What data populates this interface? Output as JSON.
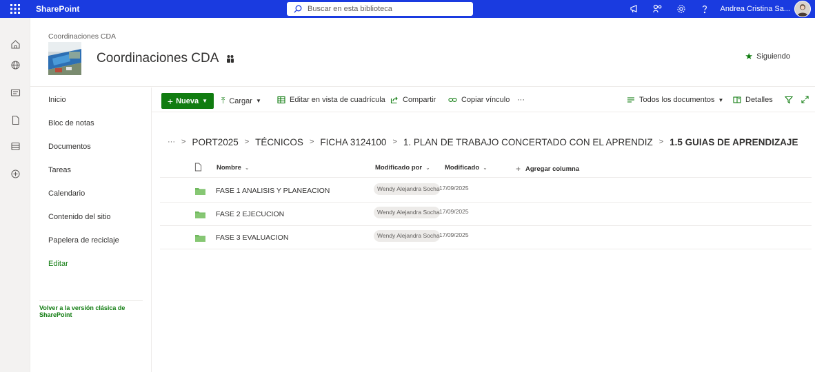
{
  "suite": {
    "brand": "SharePoint",
    "search_placeholder": "Buscar en esta biblioteca",
    "user_name": "Andrea Cristina Sa..."
  },
  "site": {
    "breadcrumb": "Coordinaciones CDA",
    "title": "Coordinaciones CDA",
    "follow_label": "Siguiendo"
  },
  "nav": {
    "items": [
      "Inicio",
      "Bloc de notas",
      "Documentos",
      "Tareas",
      "Calendario",
      "Contenido del sitio",
      "Papelera de reciclaje"
    ],
    "edit": "Editar",
    "classic": "Volver a la versión clásica de SharePoint"
  },
  "commands": {
    "new": "Nueva",
    "upload": "Cargar",
    "grid": "Editar en vista de cuadrícula",
    "share": "Compartir",
    "copy_link": "Copiar vínculo",
    "more": "···",
    "view": "Todos los documentos",
    "details": "Detalles"
  },
  "breadcrumb": {
    "ellipsis": "···",
    "items": [
      "PORT2025",
      "TÉCNICOS",
      "FICHA 3124100",
      "1. PLAN DE TRABAJO CONCERTADO CON EL APRENDIZ"
    ],
    "current": "1.5 GUIAS DE APRENDIZAJE"
  },
  "columns": {
    "name": "Nombre",
    "modified_by": "Modificado por",
    "modified": "Modificado",
    "add_column": "Agregar columna"
  },
  "rows": [
    {
      "name": "FASE 1 ANALISIS Y PLANEACION",
      "modified_by": "Wendy Alejandra Socha",
      "modified": "17/09/2025"
    },
    {
      "name": "FASE 2 EJECUCION",
      "modified_by": "Wendy Alejandra Socha",
      "modified": "17/09/2025"
    },
    {
      "name": "FASE 3 EVALUACION",
      "modified_by": "Wendy Alejandra Socha",
      "modified": "17/09/2025"
    }
  ],
  "colors": {
    "suite_bar": "#1a3be0",
    "accent_green": "#107c10",
    "folder": "#7fc36b"
  },
  "icons": [
    "waffle-icon",
    "search-icon",
    "megaphone-icon",
    "connections-icon",
    "settings-icon",
    "help-icon",
    "home-icon",
    "globe-icon",
    "news-icon",
    "file-icon",
    "list-icon",
    "add-icon",
    "star-icon",
    "folder-icon",
    "filter-icon",
    "expand-icon"
  ]
}
